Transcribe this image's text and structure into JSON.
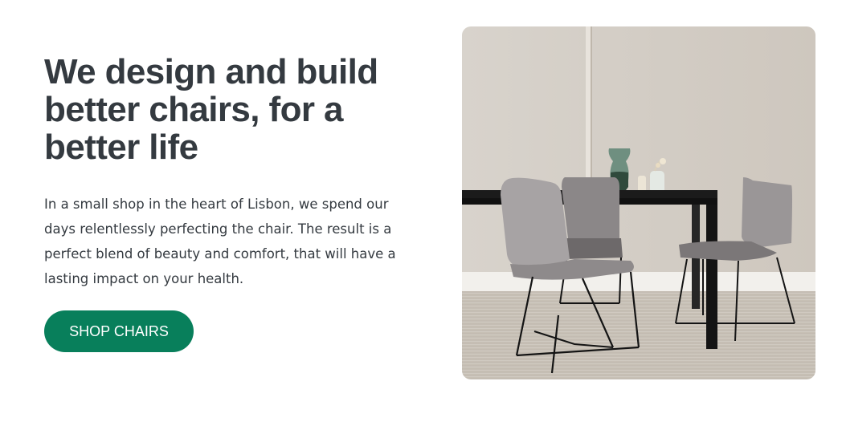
{
  "hero": {
    "headline": "We design and build better chairs, for a better life",
    "description": "In a small shop in the heart of Lisbon, we spend our days relentlessly perfecting the chair. The result is a perfect blend of beauty and comfort, that will have a lasting impact on your health.",
    "cta_label": "SHOP CHAIRS",
    "image_icon": "chairs-photo"
  },
  "colors": {
    "headline": "#343a40",
    "body_text": "#343a40",
    "cta_background": "#087f5b",
    "cta_text": "#ffffff"
  }
}
